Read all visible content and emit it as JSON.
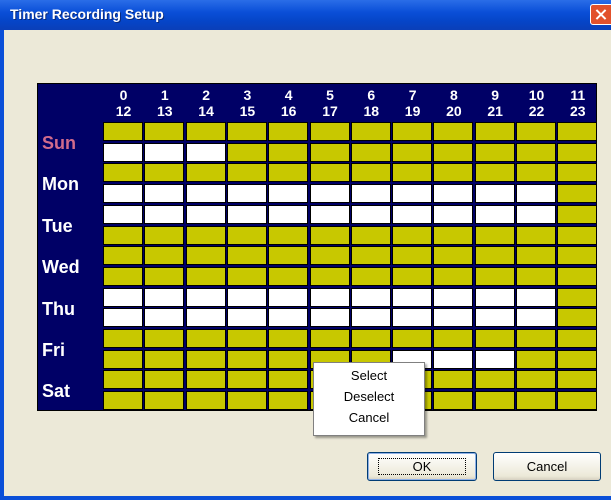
{
  "window": {
    "title": "Timer Recording Setup"
  },
  "schedule": {
    "hours_top": [
      "0",
      "1",
      "2",
      "3",
      "4",
      "5",
      "6",
      "7",
      "8",
      "9",
      "10",
      "11"
    ],
    "hours_bottom": [
      "12",
      "13",
      "14",
      "15",
      "16",
      "17",
      "18",
      "19",
      "20",
      "21",
      "22",
      "23"
    ],
    "days": [
      "Sun",
      "Mon",
      "Tue",
      "Wed",
      "Thu",
      "Fri",
      "Sat"
    ],
    "rows": [
      [
        0,
        0,
        0,
        0,
        0,
        0,
        0,
        0,
        0,
        0,
        0,
        0
      ],
      [
        1,
        1,
        1,
        0,
        0,
        0,
        0,
        0,
        0,
        0,
        0,
        0
      ],
      [
        0,
        0,
        0,
        0,
        0,
        0,
        0,
        0,
        0,
        0,
        0,
        0
      ],
      [
        1,
        1,
        1,
        1,
        1,
        1,
        1,
        1,
        1,
        1,
        1,
        0
      ],
      [
        1,
        1,
        1,
        1,
        1,
        1,
        1,
        1,
        1,
        1,
        1,
        0
      ],
      [
        0,
        0,
        0,
        0,
        0,
        0,
        0,
        0,
        0,
        0,
        0,
        0
      ],
      [
        0,
        0,
        0,
        0,
        0,
        0,
        0,
        0,
        0,
        0,
        0,
        0
      ],
      [
        0,
        0,
        0,
        0,
        0,
        0,
        0,
        0,
        0,
        0,
        0,
        0
      ],
      [
        1,
        1,
        1,
        1,
        1,
        1,
        1,
        1,
        1,
        1,
        1,
        0
      ],
      [
        1,
        1,
        1,
        1,
        1,
        1,
        1,
        1,
        1,
        1,
        1,
        0
      ],
      [
        0,
        0,
        0,
        0,
        0,
        0,
        0,
        0,
        0,
        0,
        0,
        0
      ],
      [
        0,
        0,
        0,
        0,
        0,
        0,
        0,
        1,
        1,
        1,
        0,
        0
      ],
      [
        0,
        0,
        0,
        0,
        0,
        0,
        0,
        0,
        0,
        0,
        0,
        0
      ],
      [
        0,
        0,
        0,
        0,
        0,
        0,
        0,
        0,
        0,
        0,
        0,
        0
      ]
    ],
    "colors": {
      "unselected": "#c8c800",
      "selected": "#ffffff",
      "background": "#000066",
      "sunday_label": "#d16b8c"
    }
  },
  "context_menu": {
    "items": [
      "Select",
      "Deselect",
      "Cancel"
    ]
  },
  "buttons": {
    "ok": "OK",
    "cancel": "Cancel"
  }
}
